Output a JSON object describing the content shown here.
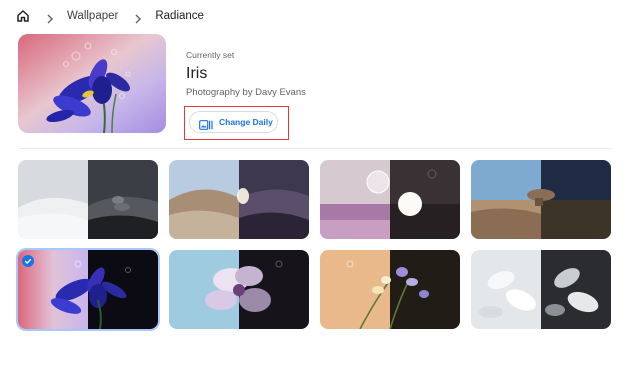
{
  "breadcrumb": {
    "home_icon": "home-icon",
    "items": [
      "Wallpaper",
      "Radiance"
    ]
  },
  "current": {
    "label": "Currently set",
    "title": "Iris",
    "credit": "Photography by Davy Evans",
    "button_label": "Change Daily",
    "button_icon": "photo-frames-icon"
  },
  "collection": {
    "name": "Radiance",
    "selected_index": 4,
    "tiles": [
      {
        "subject": "sand-dunes-and-rocks"
      },
      {
        "subject": "grassy-hill-at-dusk"
      },
      {
        "subject": "bubble-over-field"
      },
      {
        "subject": "rock-formation-in-desert"
      },
      {
        "subject": "iris"
      },
      {
        "subject": "orchid"
      },
      {
        "subject": "freesia"
      },
      {
        "subject": "white-petals"
      }
    ]
  },
  "colors": {
    "accent": "#1a73e8",
    "highlight_frame": "#e53935",
    "selected_ring": "#a8c7fa"
  }
}
